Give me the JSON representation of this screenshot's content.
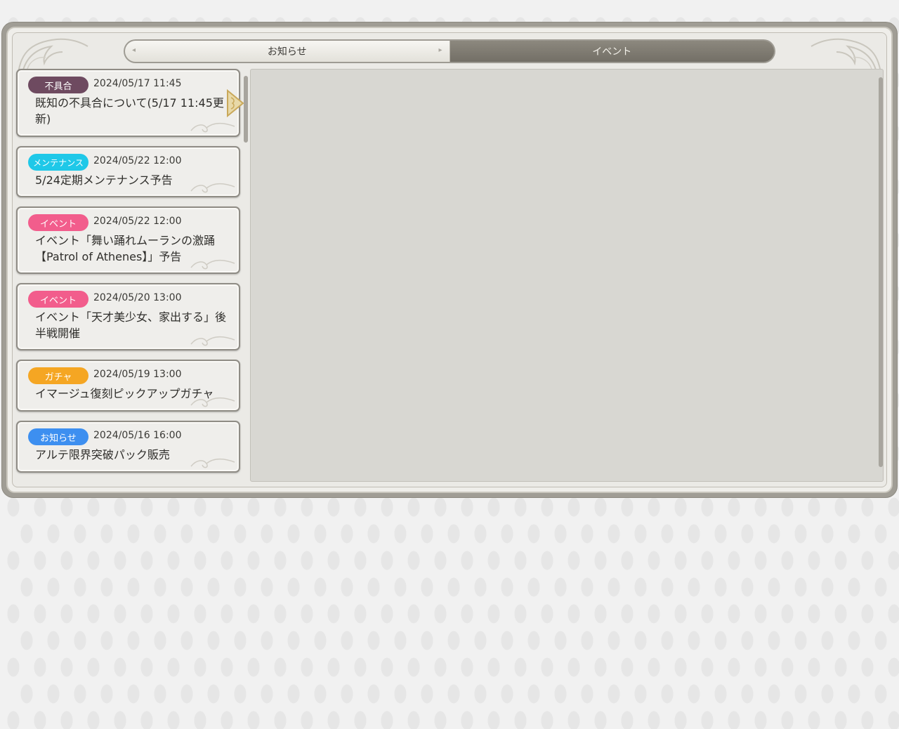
{
  "tabs": [
    {
      "label": "お知らせ",
      "active": false
    },
    {
      "label": "イベント",
      "active": true
    }
  ],
  "notices": [
    {
      "category": "不具合",
      "color": "#6e4a60",
      "date": "2024/05/17 11:45",
      "title": "既知の不具合について(5/17 11:45更新)",
      "selected": true
    },
    {
      "category": "メンテナンス",
      "color": "#1fc8e8",
      "date": "2024/05/22 12:00",
      "title": "5/24定期メンテナンス予告",
      "selected": false
    },
    {
      "category": "イベント",
      "color": "#f25d8c",
      "date": "2024/05/22 12:00",
      "title": "イベント「舞い踊れムーランの激踊【Patrol of Athenes】」予告",
      "selected": false
    },
    {
      "category": "イベント",
      "color": "#f25d8c",
      "date": "2024/05/20 13:00",
      "title": "イベント「天才美少女、家出する」後半戦開催",
      "selected": false
    },
    {
      "category": "ガチャ",
      "color": "#f5a623",
      "date": "2024/05/19 13:00",
      "title": "イマージュ復刻ピックアップガチャ",
      "selected": false
    },
    {
      "category": "お知らせ",
      "color": "#3d8ff0",
      "date": "2024/05/16 16:00",
      "title": "アルテ限界突破パック販売",
      "selected": false
    }
  ]
}
